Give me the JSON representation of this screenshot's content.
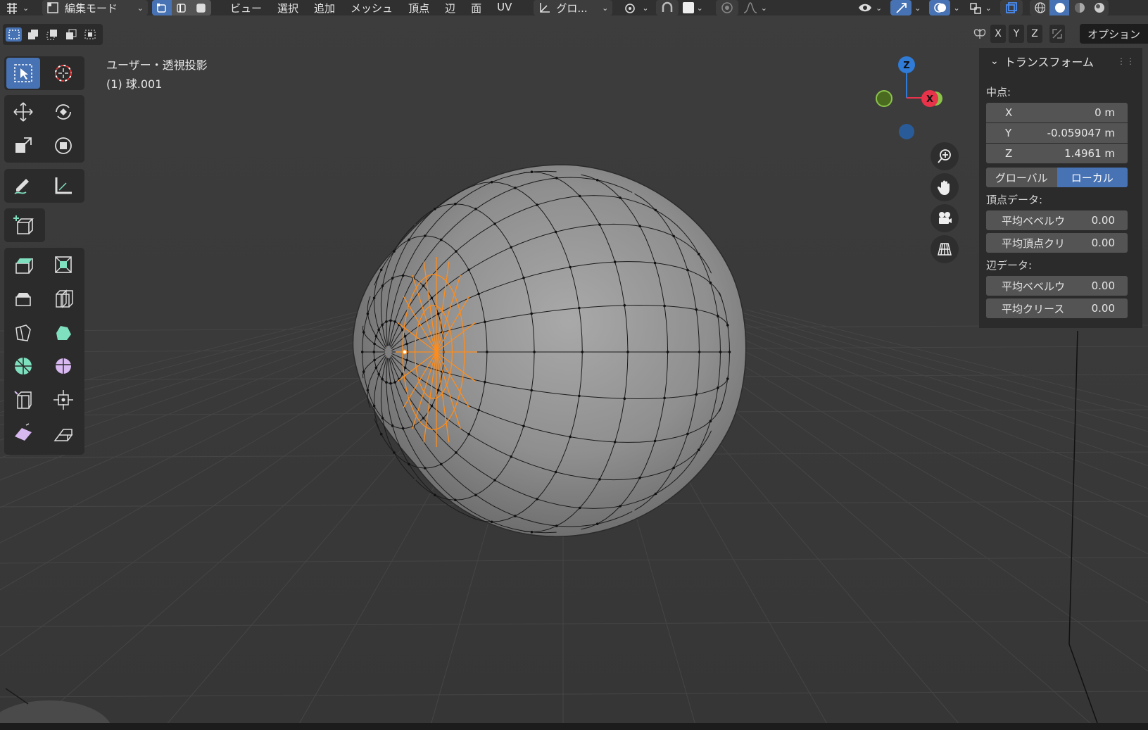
{
  "header": {
    "mode_label": "編集モード",
    "menus": [
      "ビュー",
      "選択",
      "追加",
      "メッシュ",
      "頂点",
      "辺",
      "面",
      "UV"
    ],
    "transform_orientation": "グロ...",
    "option_label": "オプション"
  },
  "axis_buttons": [
    "X",
    "Y",
    "Z"
  ],
  "viewport": {
    "title": "ユーザー・透視投影",
    "object_name": "(1) 球.001"
  },
  "gizmo": {
    "z_label": "Z",
    "x_label": "X"
  },
  "npanel": {
    "section_title": "トランスフォーム",
    "median_label": "中点:",
    "x_label": "X",
    "x_value": "0 m",
    "y_label": "Y",
    "y_value": "-0.059047 m",
    "z_label": "Z",
    "z_value": "1.4961 m",
    "global_label": "グローバル",
    "local_label": "ローカル",
    "vertex_data_label": "頂点データ:",
    "v_bevel_label": "平均ベベルウ",
    "v_bevel_value": "0.00",
    "v_crease_label": "平均頂点クリ",
    "v_crease_value": "0.00",
    "edge_data_label": "辺データ:",
    "e_bevel_label": "平均ベベルウ",
    "e_bevel_value": "0.00",
    "e_crease_label": "平均クリース",
    "e_crease_value": "0.00"
  },
  "colors": {
    "accent": "#4772b3",
    "selection": "#ff8c1a",
    "axis_x": "#e8334a",
    "axis_y": "#8bc34a",
    "axis_z": "#2f7bd6"
  }
}
